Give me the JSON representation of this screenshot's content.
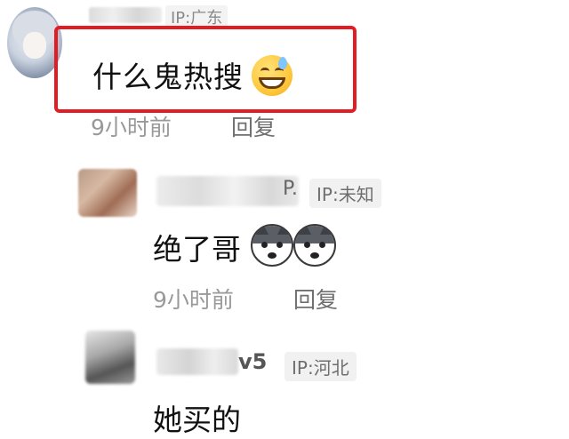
{
  "comment": {
    "ip": "IP:广东",
    "text": "什么鬼热搜",
    "emoji": "grinning-sweat-emoji",
    "time": "9小时前",
    "reply_label": "回复",
    "highlight_color": "#e31c23"
  },
  "replies": [
    {
      "name_suffix": "P.",
      "ip": "IP:未知",
      "text": "绝了哥",
      "emojis": [
        "husky-emoji",
        "husky-emoji"
      ],
      "time": "9小时前",
      "reply_label": "回复"
    },
    {
      "name_suffix": "v5",
      "ip": "IP:河北",
      "text": "她买的"
    }
  ]
}
